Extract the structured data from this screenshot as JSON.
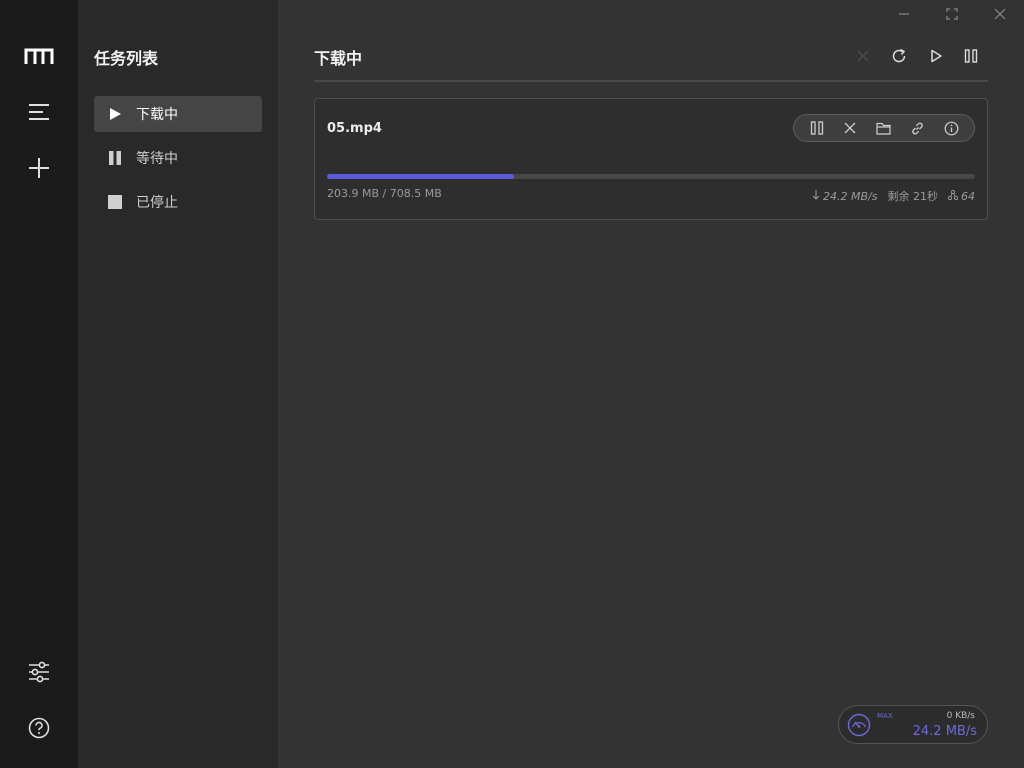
{
  "rail": {
    "logo_icon": "logo-icon",
    "items": [
      {
        "name": "task-list-icon"
      },
      {
        "name": "add-task-icon"
      },
      {
        "name": "settings-sliders-icon"
      },
      {
        "name": "help-icon"
      }
    ]
  },
  "panel": {
    "title": "任务列表",
    "items": [
      {
        "label": "下载中",
        "icon": "play-icon",
        "active": true
      },
      {
        "label": "等待中",
        "icon": "pause-icon",
        "active": false
      },
      {
        "label": "已停止",
        "icon": "stop-icon",
        "active": false
      }
    ]
  },
  "main": {
    "title": "下载中",
    "toolbar": [
      "close-icon",
      "refresh-icon",
      "play-icon",
      "pause-icon"
    ]
  },
  "window_controls": [
    "minimize-icon",
    "maximize-icon",
    "close-icon"
  ],
  "tasks": [
    {
      "name": "05.mp4",
      "progress": 0.288,
      "size_text": "203.9 MB / 708.5 MB",
      "speed": "24.2 MB/s",
      "remaining": "剩余 21秒",
      "connections": "64",
      "actions": [
        "pause-icon",
        "delete-icon",
        "folder-icon",
        "link-icon",
        "info-icon"
      ]
    }
  ],
  "speedometer": {
    "max_label": "MAX",
    "upload": "0 KB/s",
    "download": "24.2 MB/s"
  },
  "colors": {
    "accent": "#5b5bdc",
    "rail_bg": "#1b1b1b",
    "panel_bg": "#292929",
    "main_bg": "#333333"
  }
}
